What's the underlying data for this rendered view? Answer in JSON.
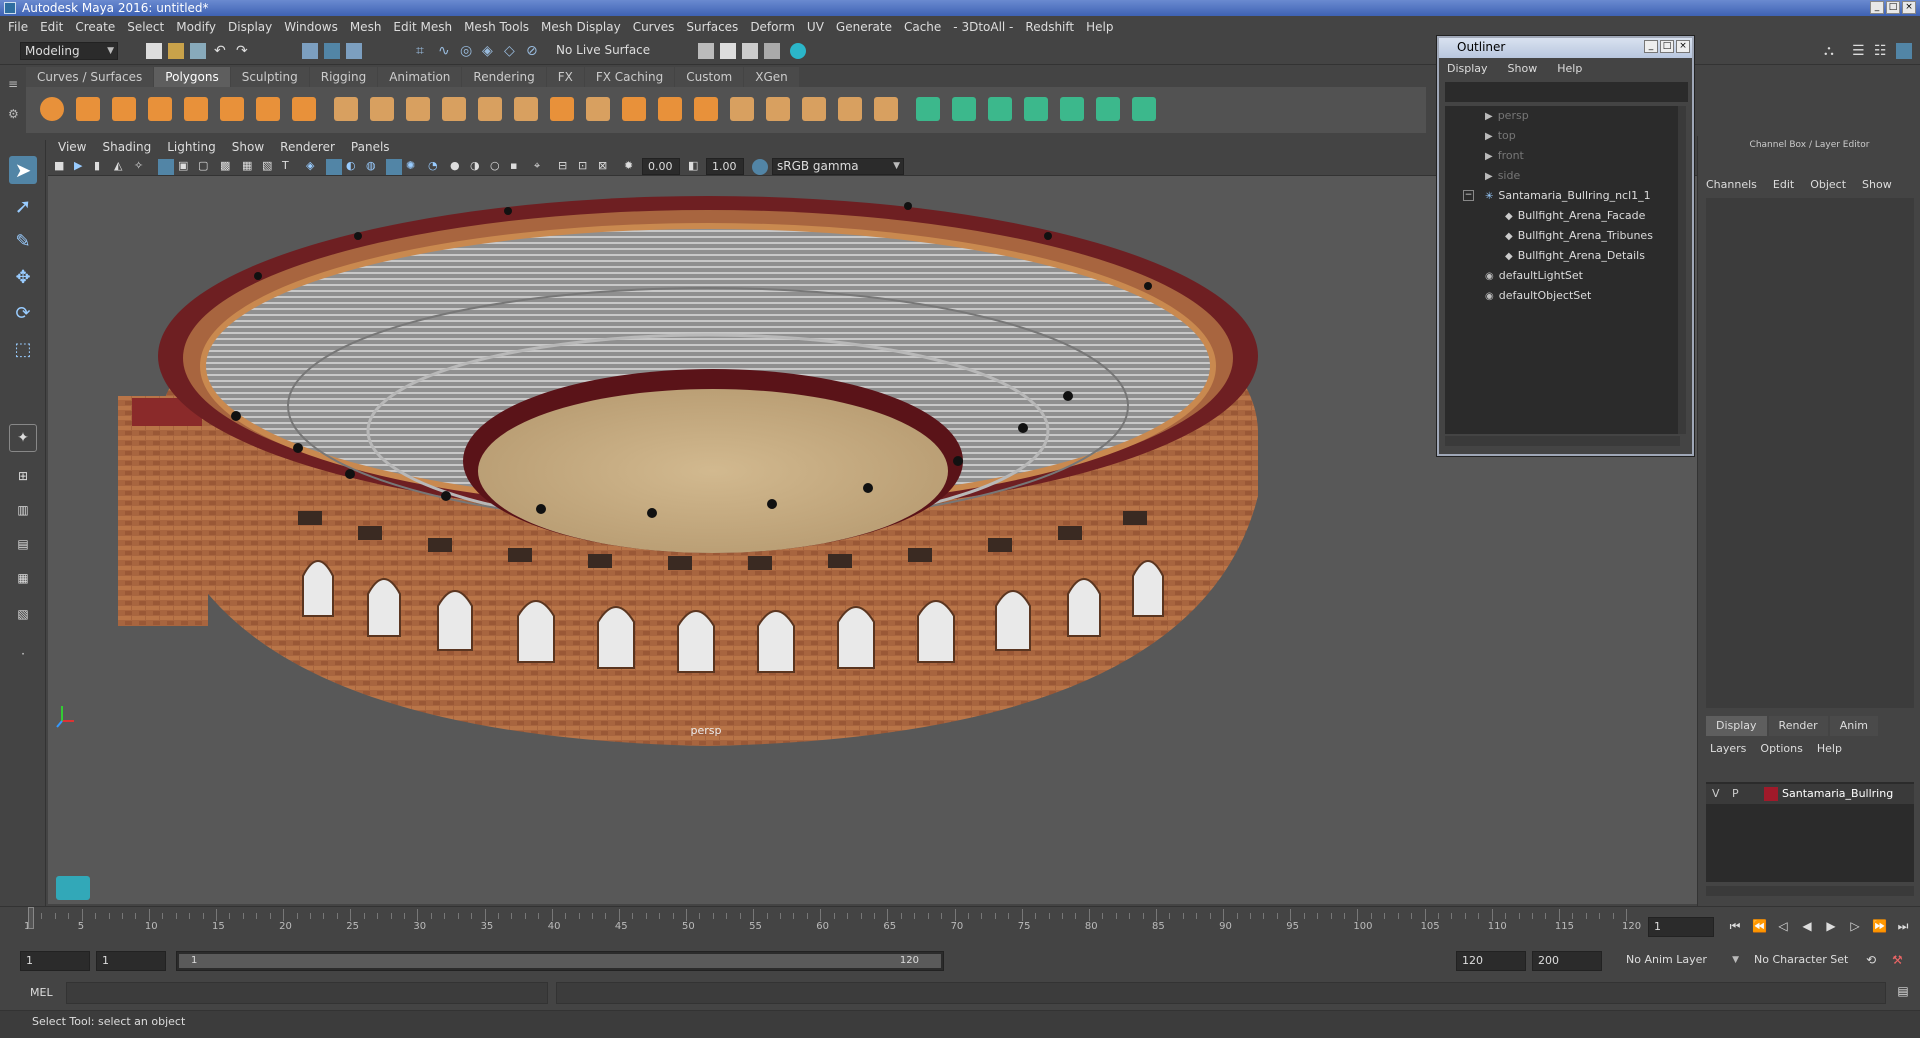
{
  "title": "Autodesk Maya 2016: untitled*",
  "window_buttons": [
    "_",
    "□",
    "×"
  ],
  "menubar": [
    "File",
    "Edit",
    "Create",
    "Select",
    "Modify",
    "Display",
    "Windows",
    "Mesh",
    "Edit Mesh",
    "Mesh Tools",
    "Mesh Display",
    "Curves",
    "Surfaces",
    "Deform",
    "UV",
    "Generate",
    "Cache",
    "- 3DtoAll -",
    "Redshift",
    "Help"
  ],
  "status_line": {
    "mode": "Modeling",
    "live_surface": "No Live Surface"
  },
  "shelf_tabs": [
    "Curves / Surfaces",
    "Polygons",
    "Sculpting",
    "Rigging",
    "Animation",
    "Rendering",
    "FX",
    "FX Caching",
    "Custom",
    "XGen"
  ],
  "active_shelf": "Polygons",
  "viewport": {
    "menu": [
      "View",
      "Shading",
      "Lighting",
      "Show",
      "Renderer",
      "Panels"
    ],
    "near_value": "0.00",
    "far_value": "1.00",
    "color_space": "sRGB gamma",
    "camera_label": "persp"
  },
  "outliner": {
    "title": "Outliner",
    "menu": [
      "Display",
      "Show",
      "Help"
    ],
    "items": [
      {
        "label": "persp",
        "indent": 0,
        "icon": "camera-icon",
        "dim": true
      },
      {
        "label": "top",
        "indent": 0,
        "icon": "camera-icon",
        "dim": true
      },
      {
        "label": "front",
        "indent": 0,
        "icon": "camera-icon",
        "dim": true
      },
      {
        "label": "side",
        "indent": 0,
        "icon": "camera-icon",
        "dim": true
      },
      {
        "label": "Santamaria_Bullring_ncl1_1",
        "indent": 0,
        "icon": "group-icon",
        "dim": false,
        "expanded": true
      },
      {
        "label": "Bullfight_Arena_Facade",
        "indent": 1,
        "icon": "mesh-icon",
        "dim": false
      },
      {
        "label": "Bullfight_Arena_Tribunes",
        "indent": 1,
        "icon": "mesh-icon",
        "dim": false
      },
      {
        "label": "Bullfight_Arena_Details",
        "indent": 1,
        "icon": "mesh-icon",
        "dim": false
      },
      {
        "label": "defaultLightSet",
        "indent": 0,
        "icon": "set-icon",
        "dim": false
      },
      {
        "label": "defaultObjectSet",
        "indent": 0,
        "icon": "set-icon",
        "dim": false
      }
    ]
  },
  "channel_box": {
    "title": "Channel Box / Layer Editor",
    "menu": [
      "Channels",
      "Edit",
      "Object",
      "Show"
    ]
  },
  "layer_editor": {
    "tabs": [
      "Display",
      "Render",
      "Anim"
    ],
    "active_tab": "Display",
    "menu": [
      "Layers",
      "Options",
      "Help"
    ],
    "layer": {
      "v": "V",
      "p": "P",
      "name": "Santamaria_Bullring",
      "color": "#a01a2a"
    }
  },
  "timeline": {
    "ticks": [
      "1",
      "5",
      "10",
      "15",
      "20",
      "25",
      "30",
      "35",
      "40",
      "45",
      "50",
      "55",
      "60",
      "65",
      "70",
      "75",
      "80",
      "85",
      "90",
      "95",
      "100",
      "105",
      "110",
      "115",
      "120"
    ],
    "current_frame": "1"
  },
  "range": {
    "start": "1",
    "playback_start": "1",
    "slider_start": "1",
    "slider_end": "120",
    "playback_end": "120",
    "end": "200",
    "anim_layer": "No Anim Layer",
    "character_set": "No Character Set"
  },
  "command_line": {
    "label": "MEL"
  },
  "help_line": "Select Tool: select an object",
  "colors": {
    "accent": "#5285a6",
    "layer_color": "#a01a2a",
    "title_bar": "#3e62b4"
  }
}
